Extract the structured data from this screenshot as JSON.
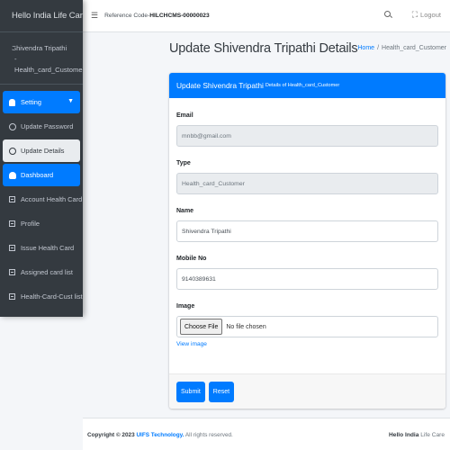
{
  "sidebar": {
    "brand": "Hello India Life Care",
    "user": {
      "name": "Shivendra Tripathi",
      "role": "- Health_card_Customer"
    },
    "items": [
      {
        "label": "Setting",
        "icon": "gear-icon"
      },
      {
        "label": "Update Password",
        "icon": "circle-icon"
      },
      {
        "label": "Update Details",
        "icon": "circle-icon"
      },
      {
        "label": "Dashboard",
        "icon": "dashboard-icon"
      },
      {
        "label": "Account Health Card",
        "icon": "card-icon"
      },
      {
        "label": "Profile",
        "icon": "card-icon"
      },
      {
        "label": "Issue Health Card",
        "icon": "card-icon"
      },
      {
        "label": "Assigned card list",
        "icon": "card-icon"
      },
      {
        "label": "Health-Card-Cust list",
        "icon": "card-icon"
      }
    ]
  },
  "topbar": {
    "ref_prefix": "Reference Code-",
    "ref_code": "HILCHCMS-00000023",
    "logout": "Logout"
  },
  "page": {
    "title": "Update Shivendra Tripathi Details",
    "breadcrumb": {
      "home": "Home",
      "separator": "/",
      "current": "Health_card_Customer"
    }
  },
  "card": {
    "title": "Update Shivendra Tripathi",
    "subtitle": "Details of Health_card_Customer",
    "fields": {
      "email": {
        "label": "Email",
        "value": "mnbb@gmail.com"
      },
      "type": {
        "label": "Type",
        "value": "Health_card_Customer"
      },
      "name": {
        "label": "Name",
        "value": "Shivendra Tripathi"
      },
      "mobile": {
        "label": "Mobile No",
        "value": "9140389631"
      },
      "image": {
        "label": "Image",
        "button": "Choose File",
        "status": "No file chosen",
        "view_link": "View image"
      }
    },
    "submit": "Submit",
    "reset": "Reset"
  },
  "footer": {
    "copyright_prefix": "Copyright © 2023",
    "company": "UIFS Technology.",
    "rights": "All rights reserved.",
    "brand_bold": "Hello India",
    "brand_rest": "Life Care"
  },
  "colors": {
    "primary": "#007bff",
    "sidebar": "#343a40"
  }
}
